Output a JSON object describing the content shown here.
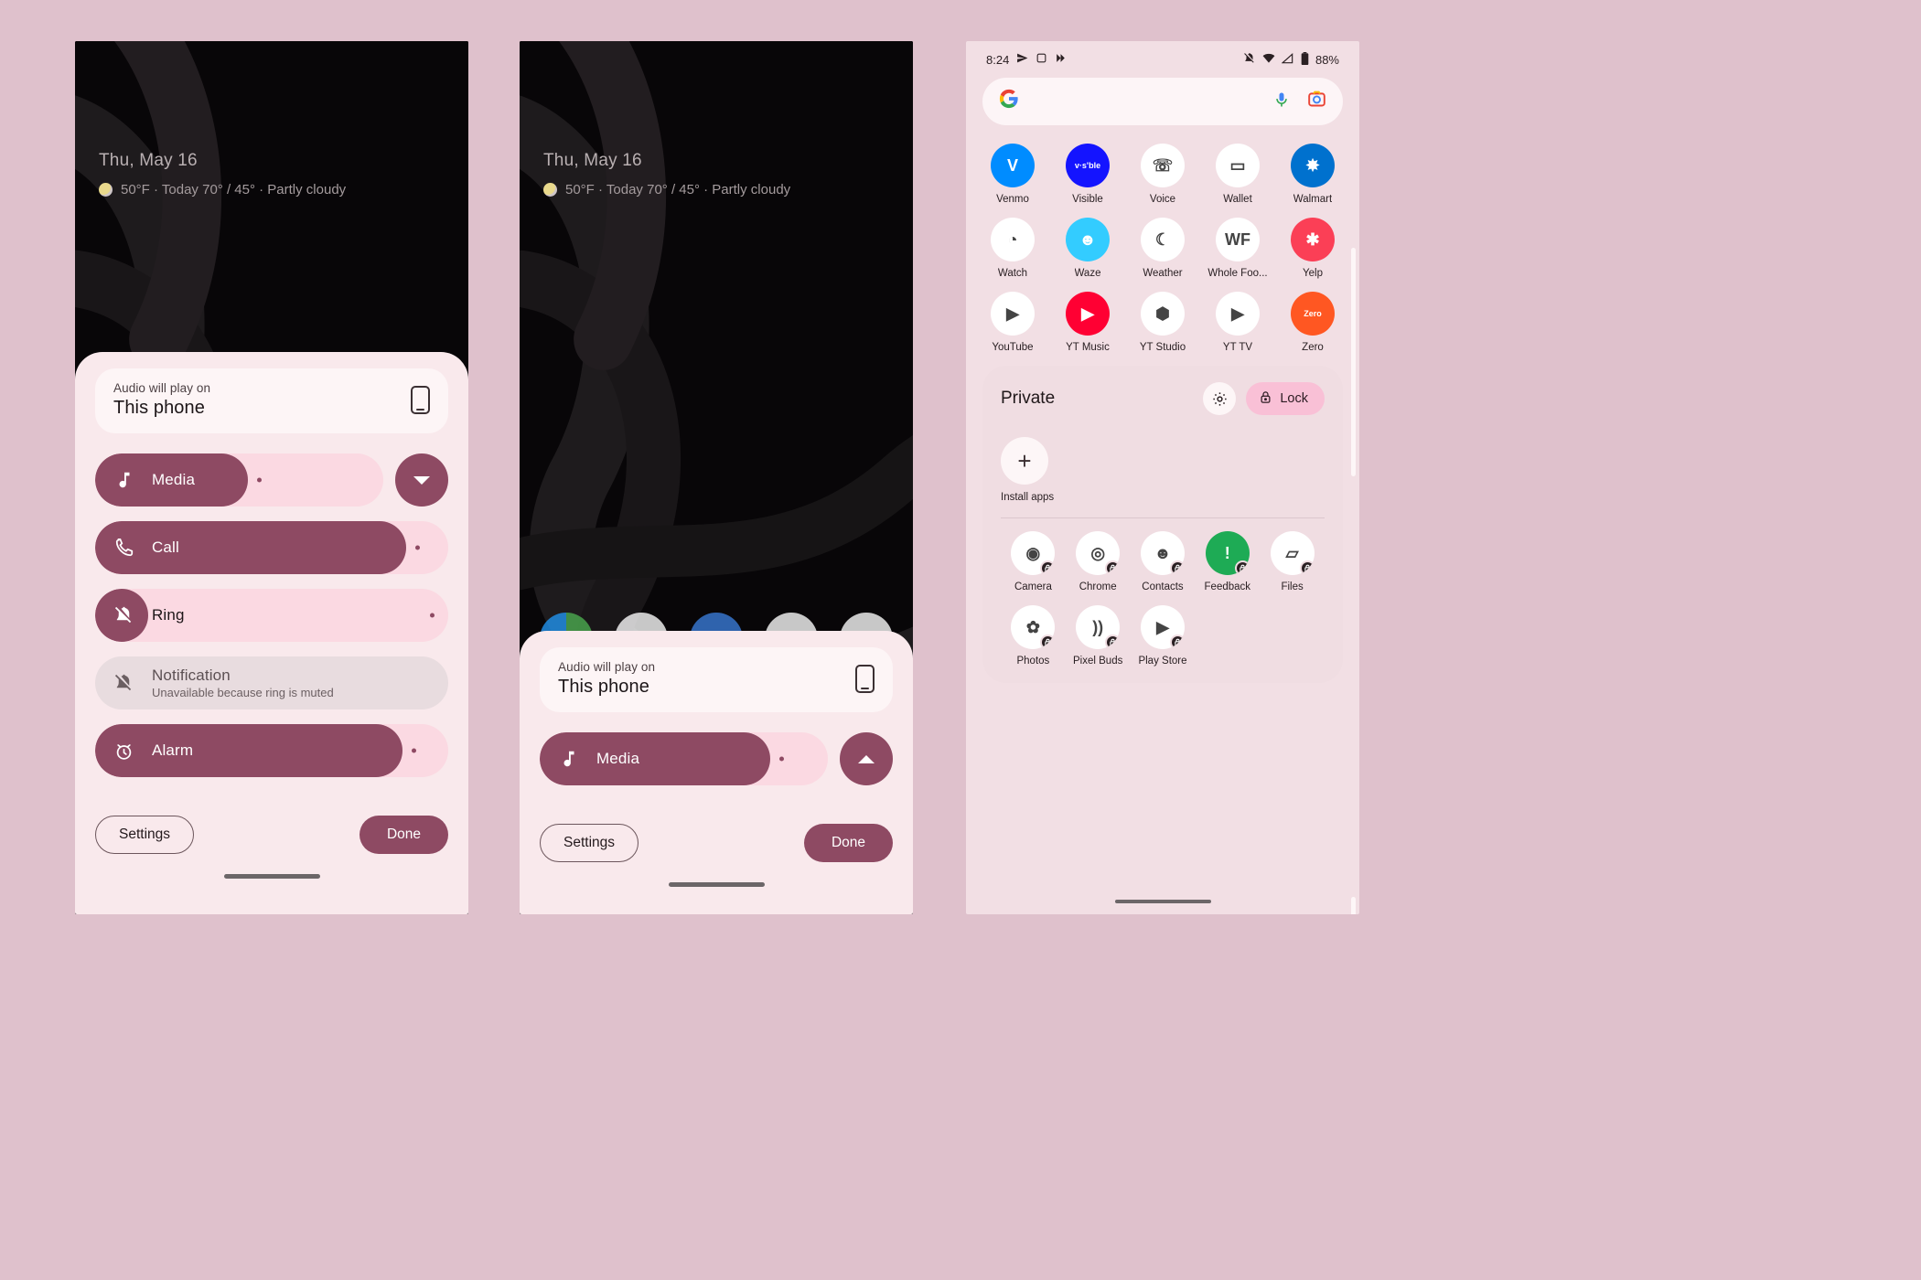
{
  "screen": {
    "background_color": "#dfc1cc",
    "panel_count": 3
  },
  "lockscreen": {
    "date": "Thu, May 16",
    "weather": "50°F  · Today 70° / 45° · Partly cloudy",
    "weather_icon": "partly-cloudy-icon"
  },
  "volume_panel": {
    "output_label": "Audio will play on",
    "output_device": "This phone",
    "output_icon": "phone-icon",
    "expanded": {
      "rows": [
        {
          "name": "media",
          "label": "Media",
          "icon": "music-note-icon",
          "level": 53,
          "state": "active",
          "sub": ""
        },
        {
          "name": "call",
          "label": "Call",
          "icon": "phone-call-icon",
          "level": 88,
          "state": "active",
          "sub": ""
        },
        {
          "name": "ring",
          "label": "Ring",
          "icon": "bell-muted-icon",
          "level": 0,
          "state": "muted",
          "sub": ""
        },
        {
          "name": "notification",
          "label": "Notification",
          "icon": "bell-muted-icon",
          "level": 0,
          "state": "disabled",
          "sub": "Unavailable because ring is muted"
        },
        {
          "name": "alarm",
          "label": "Alarm",
          "icon": "alarm-clock-icon",
          "level": 87,
          "state": "active",
          "sub": ""
        }
      ],
      "expander_icon": "chevron-down-icon"
    },
    "collapsed": {
      "rows": [
        {
          "name": "media",
          "label": "Media",
          "icon": "music-note-icon",
          "level": 80,
          "state": "active",
          "sub": ""
        }
      ],
      "expander_icon": "chevron-up-icon"
    },
    "settings_label": "Settings",
    "done_label": "Done",
    "accent_color": "#8e4a63",
    "track_color": "#fbd9e2",
    "surface_color": "#f9e9ec"
  },
  "drawer": {
    "statusbar": {
      "time": "8:24",
      "left_icons": [
        "send-icon",
        "square-icon",
        "play-triangle-icon"
      ],
      "right_icons": [
        "ring-muted-icon",
        "wifi-icon",
        "signal-icon",
        "battery-icon"
      ],
      "battery": "88%"
    },
    "search": {
      "placeholder": "",
      "logo": "google-g-icon",
      "mic_icon": "microphone-icon",
      "lens_icon": "google-lens-icon"
    },
    "apps": [
      {
        "label": "Venmo",
        "icon": "venmo-icon",
        "bg": "#008cff",
        "glyph": "V"
      },
      {
        "label": "Visible",
        "icon": "visible-icon",
        "bg": "#1414ff",
        "glyph": "v·s'ble"
      },
      {
        "label": "Voice",
        "icon": "google-voice-icon",
        "bg": "#ffffff",
        "glyph": "☏"
      },
      {
        "label": "Wallet",
        "icon": "google-wallet-icon",
        "bg": "#ffffff",
        "glyph": "▭"
      },
      {
        "label": "Walmart",
        "icon": "walmart-icon",
        "bg": "#0071ce",
        "glyph": "✸"
      },
      {
        "label": "Watch",
        "icon": "pixel-watch-icon",
        "bg": "#ffffff",
        "glyph": "◔"
      },
      {
        "label": "Waze",
        "icon": "waze-icon",
        "bg": "#33ccff",
        "glyph": "☻"
      },
      {
        "label": "Weather",
        "icon": "weather-icon",
        "bg": "#ffffff",
        "glyph": "☾"
      },
      {
        "label": "Whole Foo...",
        "icon": "whole-foods-icon",
        "bg": "#ffffff",
        "glyph": "WF"
      },
      {
        "label": "Yelp",
        "icon": "yelp-icon",
        "bg": "#fb3f56",
        "glyph": "✱"
      },
      {
        "label": "YouTube",
        "icon": "youtube-icon",
        "bg": "#ffffff",
        "glyph": "▶"
      },
      {
        "label": "YT Music",
        "icon": "yt-music-icon",
        "bg": "#ff0033",
        "glyph": "▶"
      },
      {
        "label": "YT Studio",
        "icon": "yt-studio-icon",
        "bg": "#ffffff",
        "glyph": "⬢"
      },
      {
        "label": "YT TV",
        "icon": "yt-tv-icon",
        "bg": "#ffffff",
        "glyph": "▶"
      },
      {
        "label": "Zero",
        "icon": "zero-icon",
        "bg": "#ff5722",
        "glyph": "Zero"
      }
    ],
    "private_space": {
      "title": "Private",
      "settings_icon": "gear-icon",
      "lock_label": "Lock",
      "lock_icon": "lock-icon",
      "install_label": "Install apps",
      "install_icon": "plus-icon",
      "lock_button_color": "#f9c0d6",
      "apps": [
        {
          "label": "Camera",
          "icon": "camera-icon",
          "bg": "#ffffff",
          "glyph": "◉"
        },
        {
          "label": "Chrome",
          "icon": "chrome-icon",
          "bg": "#ffffff",
          "glyph": "◎"
        },
        {
          "label": "Contacts",
          "icon": "contacts-icon",
          "bg": "#ffffff",
          "glyph": "☻"
        },
        {
          "label": "Feedback",
          "icon": "feedback-icon",
          "bg": "#1eab55",
          "glyph": "!"
        },
        {
          "label": "Files",
          "icon": "files-icon",
          "bg": "#ffffff",
          "glyph": "▱"
        },
        {
          "label": "Photos",
          "icon": "google-photos-icon",
          "bg": "#ffffff",
          "glyph": "✿"
        },
        {
          "label": "Pixel Buds",
          "icon": "pixel-buds-icon",
          "bg": "#ffffff",
          "glyph": "))"
        },
        {
          "label": "Play Store",
          "icon": "play-store-icon",
          "bg": "#ffffff",
          "glyph": "▶"
        }
      ]
    },
    "nav_pill": "home-gesture-pill"
  }
}
